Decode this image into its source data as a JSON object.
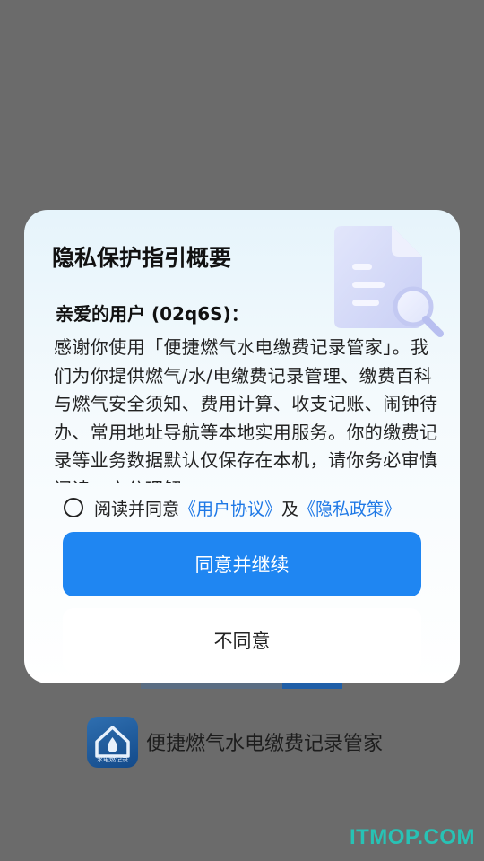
{
  "dialog": {
    "title": "隐私保护指引概要",
    "greeting": "亲爱的用户 (02q6S)：",
    "body": "感谢你使用「便捷燃气水电缴费记录管家」。我们为你提供燃气/水/电缴费记录管理、缴费百科与燃气安全须知、费用计算、收支记账、闹钟待办、常用地址导航等本地实用服务。你的缴费记录等业务数据默认仅保存在本机，请你务必审慎阅读，充分理解",
    "consent_prefix": "阅读并同意",
    "user_agreement_link": "《用户协议》",
    "consent_and": "及",
    "privacy_policy_link": "《隐私政策》",
    "agree_button": "同意并继续",
    "disagree_button": "不同意",
    "illustration_icon": "document-search-icon"
  },
  "background": {
    "app_logo_caption": "水电燃记录",
    "app_name": "便捷燃气水电缴费记录管家"
  },
  "watermark": "ITMOP.COM",
  "colors": {
    "accent": "#1f86f2",
    "link": "#1e78e6",
    "overlay": "#6b6b6b"
  }
}
